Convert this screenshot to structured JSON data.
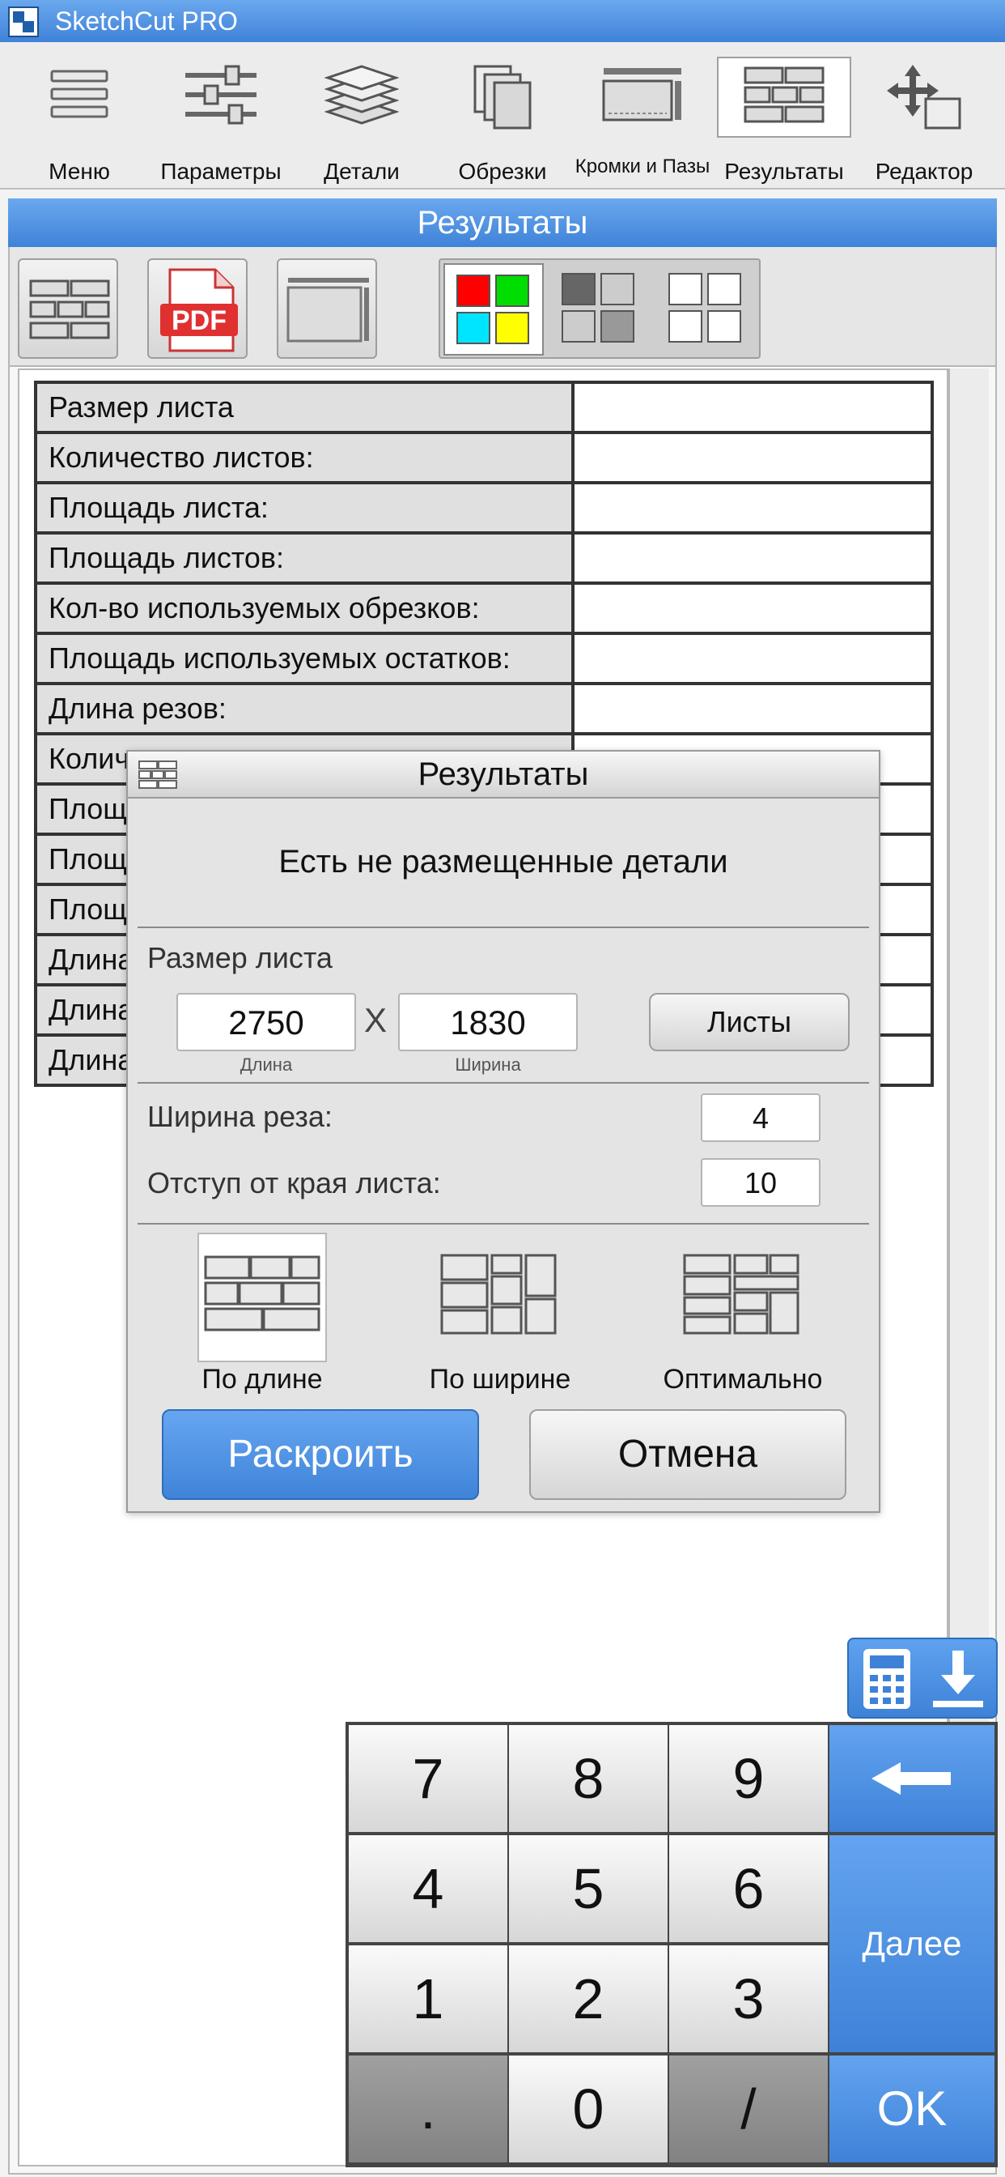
{
  "app": {
    "title": "SketchCut PRO"
  },
  "toolbar": {
    "items": [
      {
        "label": "Меню",
        "icon": "hamburger-menu-icon"
      },
      {
        "label": "Параметры",
        "icon": "sliders-icon"
      },
      {
        "label": "Детали",
        "icon": "layers-stack-icon"
      },
      {
        "label": "Обрезки",
        "icon": "stacked-sheets-icon"
      },
      {
        "label": "Кромки и Пазы",
        "icon": "edge-panel-icon"
      },
      {
        "label": "Результаты",
        "icon": "cutting-layout-icon",
        "active": true
      },
      {
        "label": "Редактор",
        "icon": "move-arrows-icon"
      }
    ]
  },
  "results_panel": {
    "title": "Результаты",
    "toolbar_icons": [
      "cutting-layout-icon",
      "pdf-icon",
      "sheet-edge-icon"
    ],
    "color_modes": [
      "color-blocks-icon",
      "grey-blocks-icon",
      "white-blocks-icon"
    ],
    "table": {
      "rows": [
        {
          "label": "Размер листа",
          "value": ""
        },
        {
          "label": "Количество листов:",
          "value": ""
        },
        {
          "label": "Площадь листа:",
          "value": ""
        },
        {
          "label": "Площадь листов:",
          "value": ""
        },
        {
          "label": "Кол-во используемых обрезков:",
          "value": ""
        },
        {
          "label": "Площадь используемых остатков:",
          "value": ""
        },
        {
          "label": "Длина резов:",
          "value": ""
        },
        {
          "label": "Колич",
          "value": ""
        },
        {
          "label": "Площ",
          "value": ""
        },
        {
          "label": "Площ",
          "value": ""
        },
        {
          "label": "Площ",
          "value": ""
        },
        {
          "label": "Длина",
          "value": ""
        },
        {
          "label": "Длина",
          "value": ""
        },
        {
          "label": "Длина",
          "value": ""
        }
      ]
    }
  },
  "dialog": {
    "title": "Результаты",
    "message": "Есть не размещенные детали",
    "sheet_size_label": "Размер листа",
    "length_value": "2750",
    "length_caption": "Длина",
    "times": "X",
    "width_value": "1830",
    "width_caption": "Ширина",
    "sheets_button": "Листы",
    "kerf_label": "Ширина реза:",
    "kerf_value": "4",
    "margin_label": "Отступ от края листа:",
    "margin_value": "10",
    "modes": [
      {
        "label": "По длине",
        "active": true
      },
      {
        "label": "По ширине",
        "active": false
      },
      {
        "label": "Оптимально",
        "active": false
      }
    ],
    "cut_button": "Раскроить",
    "cancel_button": "Отмена"
  },
  "keypad": {
    "keys": [
      "7",
      "8",
      "9",
      "4",
      "5",
      "6",
      "1",
      "2",
      "3",
      ".",
      "0",
      "/"
    ],
    "next_label": "Далее",
    "ok_label": "OK"
  },
  "colors": {
    "accent_blue": "#4a8ee0",
    "pdf_red": "#e03030"
  }
}
